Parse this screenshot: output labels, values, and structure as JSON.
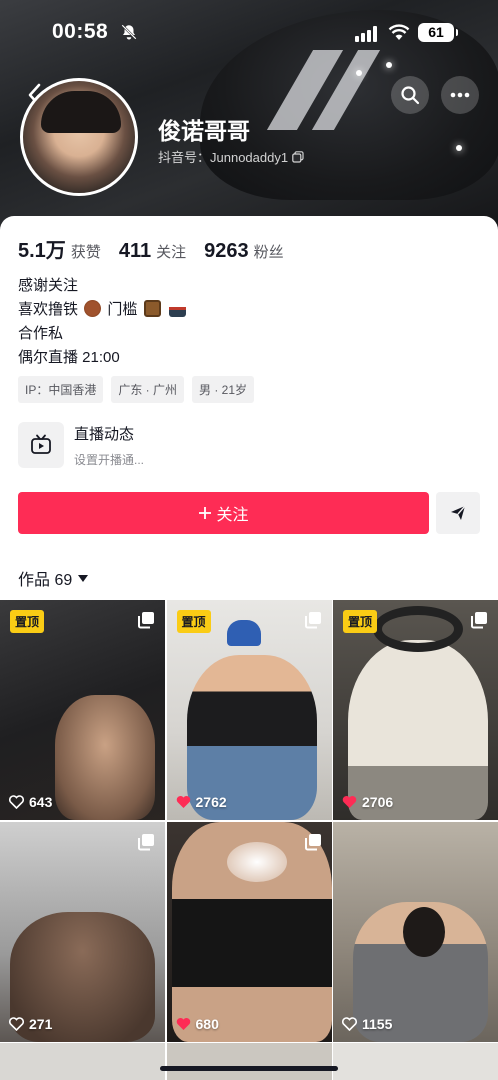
{
  "status_bar": {
    "time": "00:58",
    "battery": "61"
  },
  "profile": {
    "nickname": "俊诺哥哥",
    "douyin_id": "抖音号：Junnodaddy1",
    "stats": [
      {
        "num": "5.1万",
        "label": "获赞"
      },
      {
        "num": "411",
        "label": "关注"
      },
      {
        "num": "9263",
        "label": "粉丝"
      }
    ],
    "bio": {
      "line1": "感谢关注",
      "line2_prefix": "喜欢撸铁",
      "line2_mid": "门槛",
      "line3": "合作私",
      "line4": "偶尔直播 21:00"
    },
    "tags": [
      "IP：中国香港",
      "广东 · 广州",
      "男 · 21岁"
    ],
    "live_entry": {
      "title": "直播动态",
      "subtitle": "设置开播通..."
    },
    "follow_label": "关注",
    "works_label": "作品 69"
  },
  "colors": {
    "accent": "#fe2c55",
    "pin_badge": "#facc15"
  },
  "grid": [
    {
      "pinned": true,
      "pin_label": "置顶",
      "likes": "643",
      "liked": false
    },
    {
      "pinned": true,
      "pin_label": "置顶",
      "likes": "2762",
      "liked": true
    },
    {
      "pinned": true,
      "pin_label": "置顶",
      "likes": "2706",
      "liked": true
    },
    {
      "pinned": false,
      "likes": "271",
      "liked": false
    },
    {
      "pinned": false,
      "likes": "680",
      "liked": true
    },
    {
      "pinned": false,
      "likes": "1155",
      "liked": false
    }
  ],
  "icons": [
    "bell-slash-icon",
    "signal-icon",
    "wifi-icon",
    "back-icon",
    "search-icon",
    "more-icon",
    "copy-icon",
    "live-tv-icon",
    "plus-icon",
    "share-icon",
    "heart-icon",
    "multi-image-icon"
  ]
}
